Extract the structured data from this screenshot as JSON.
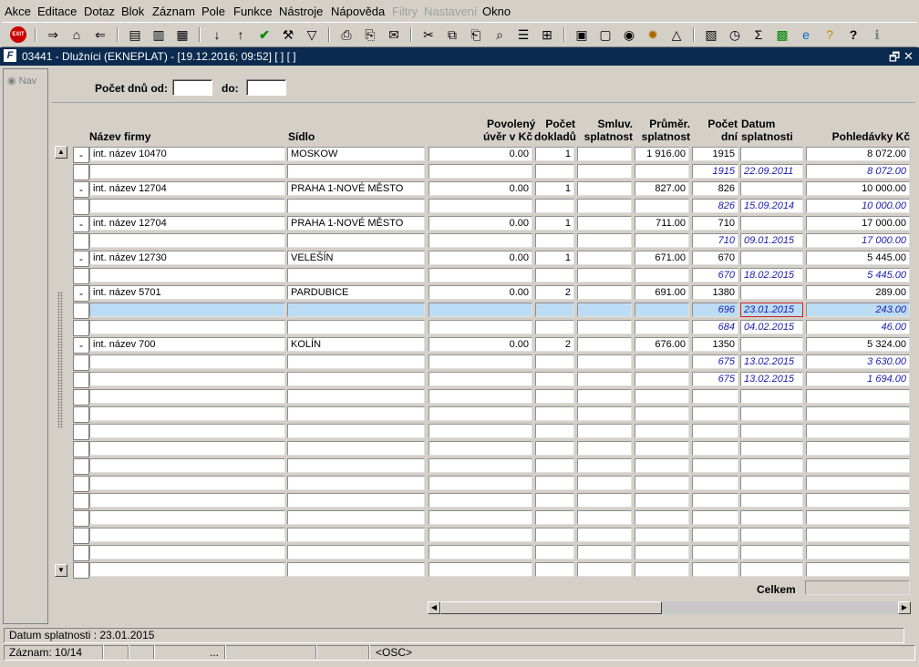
{
  "menu": [
    "Akce",
    "Editace",
    "Dotaz",
    "Blok",
    "Záznam",
    "Pole",
    "Funkce",
    "Nástroje",
    "Nápověda",
    "Filtry",
    "Nastavení",
    "Okno"
  ],
  "menu_disabled": [
    "Filtry",
    "Nastavení"
  ],
  "toolbar": {
    "icons": [
      "exit-icon",
      "insert-record-icon",
      "delete-record-icon",
      "duplicate-record-icon",
      "copy-record-icon",
      "paste-record-icon",
      "clear-record-icon",
      "sort-asc-icon",
      "sort-desc-icon",
      "accept-icon",
      "tools-icon",
      "filter-icon",
      "print-icon",
      "print-setup-icon",
      "email-icon",
      "cut-icon",
      "copy-icon",
      "paste-icon",
      "help-lookup-icon",
      "list-icon",
      "tree-icon",
      "report-icon",
      "document-icon",
      "globe-icon",
      "settings-icon",
      "warning-icon",
      "chart-icon",
      "clock-icon",
      "sum-icon",
      "excel-icon",
      "ie-icon",
      "help-query-icon",
      "help-icon",
      "info-icon"
    ],
    "exit_label": "EXIT"
  },
  "window": {
    "title": "03441 - Dlužníci (EKNEPLAT) - [19.12.2016; 09:52] [ ] [ ]",
    "restore_glyph": "🗗",
    "close_glyph": "✕"
  },
  "nav_label": "Nav",
  "filter": {
    "days_from_label": "Počet dnů od:",
    "days_from_value": "",
    "to_label": "do:",
    "to_value": ""
  },
  "columns": {
    "firm": "Název firmy",
    "seat": "Sídlo",
    "credit_1": "Povolený",
    "credit_2": "úvěr v Kč",
    "docs_1": "Počet",
    "docs_2": "dokladů",
    "contract_1": "Smluv.",
    "contract_2": "splatnost",
    "avg_1": "Průměr.",
    "avg_2": "splatnost",
    "days_1": "Počet",
    "days_2": "dní",
    "due_1": "Datum",
    "due_2": "splatnosti",
    "claims": "Pohledávky Kč"
  },
  "rows": [
    {
      "ind": "-",
      "firm": "int. název 10470",
      "seat": "MOSKOW",
      "credit": "0.00",
      "docs": "1",
      "contract": "",
      "avg": "1 916.00",
      "days": "1915",
      "due": "",
      "claims": "8 072.00",
      "sub": false
    },
    {
      "ind": "",
      "firm": "",
      "seat": "",
      "credit": "",
      "docs": "",
      "contract": "",
      "avg": "",
      "days": "1915",
      "due": "22.09.2011",
      "claims": "8 072.00",
      "sub": true
    },
    {
      "ind": "-",
      "firm": "int. název 12704",
      "seat": "PRAHA 1-NOVÉ MĚSTO",
      "credit": "0.00",
      "docs": "1",
      "contract": "",
      "avg": "827.00",
      "days": "826",
      "due": "",
      "claims": "10 000.00",
      "sub": false
    },
    {
      "ind": "",
      "firm": "",
      "seat": "",
      "credit": "",
      "docs": "",
      "contract": "",
      "avg": "",
      "days": "826",
      "due": "15.09.2014",
      "claims": "10 000.00",
      "sub": true
    },
    {
      "ind": "-",
      "firm": "int. název 12704",
      "seat": "PRAHA 1-NOVÉ MĚSTO",
      "credit": "0.00",
      "docs": "1",
      "contract": "",
      "avg": "711.00",
      "days": "710",
      "due": "",
      "claims": "17 000.00",
      "sub": false
    },
    {
      "ind": "",
      "firm": "",
      "seat": "",
      "credit": "",
      "docs": "",
      "contract": "",
      "avg": "",
      "days": "710",
      "due": "09.01.2015",
      "claims": "17 000.00",
      "sub": true
    },
    {
      "ind": "-",
      "firm": "int. název 12730",
      "seat": "VELEŠÍN",
      "credit": "0.00",
      "docs": "1",
      "contract": "",
      "avg": "671.00",
      "days": "670",
      "due": "",
      "claims": "5 445.00",
      "sub": false
    },
    {
      "ind": "",
      "firm": "",
      "seat": "",
      "credit": "",
      "docs": "",
      "contract": "",
      "avg": "",
      "days": "670",
      "due": "18.02.2015",
      "claims": "5 445.00",
      "sub": true
    },
    {
      "ind": "-",
      "firm": "int. název 5701",
      "seat": "PARDUBICE",
      "credit": "0.00",
      "docs": "2",
      "contract": "",
      "avg": "691.00",
      "days": "1380",
      "due": "",
      "claims": "289.00",
      "sub": false
    },
    {
      "ind": "",
      "firm": "",
      "seat": "",
      "credit": "",
      "docs": "",
      "contract": "",
      "avg": "",
      "days": "696",
      "due": "23.01.2015",
      "claims": "243.00",
      "sub": true,
      "selected": true
    },
    {
      "ind": "",
      "firm": "",
      "seat": "",
      "credit": "",
      "docs": "",
      "contract": "",
      "avg": "",
      "days": "684",
      "due": "04.02.2015",
      "claims": "46.00",
      "sub": true
    },
    {
      "ind": "-",
      "firm": "int. název 700",
      "seat": "KOLÍN",
      "credit": "0.00",
      "docs": "2",
      "contract": "",
      "avg": "676.00",
      "days": "1350",
      "due": "",
      "claims": "5 324.00",
      "sub": false
    },
    {
      "ind": "",
      "firm": "",
      "seat": "",
      "credit": "",
      "docs": "",
      "contract": "",
      "avg": "",
      "days": "675",
      "due": "13.02.2015",
      "claims": "3 630.00",
      "sub": true
    },
    {
      "ind": "",
      "firm": "",
      "seat": "",
      "credit": "",
      "docs": "",
      "contract": "",
      "avg": "",
      "days": "675",
      "due": "13.02.2015",
      "claims": "1 694.00",
      "sub": true
    },
    {
      "ind": "",
      "firm": "",
      "seat": "",
      "credit": "",
      "docs": "",
      "contract": "",
      "avg": "",
      "days": "",
      "due": "",
      "claims": "",
      "sub": false
    },
    {
      "ind": "",
      "firm": "",
      "seat": "",
      "credit": "",
      "docs": "",
      "contract": "",
      "avg": "",
      "days": "",
      "due": "",
      "claims": "",
      "sub": false
    },
    {
      "ind": "",
      "firm": "",
      "seat": "",
      "credit": "",
      "docs": "",
      "contract": "",
      "avg": "",
      "days": "",
      "due": "",
      "claims": "",
      "sub": false
    },
    {
      "ind": "",
      "firm": "",
      "seat": "",
      "credit": "",
      "docs": "",
      "contract": "",
      "avg": "",
      "days": "",
      "due": "",
      "claims": "",
      "sub": false
    },
    {
      "ind": "",
      "firm": "",
      "seat": "",
      "credit": "",
      "docs": "",
      "contract": "",
      "avg": "",
      "days": "",
      "due": "",
      "claims": "",
      "sub": false
    },
    {
      "ind": "",
      "firm": "",
      "seat": "",
      "credit": "",
      "docs": "",
      "contract": "",
      "avg": "",
      "days": "",
      "due": "",
      "claims": "",
      "sub": false
    },
    {
      "ind": "",
      "firm": "",
      "seat": "",
      "credit": "",
      "docs": "",
      "contract": "",
      "avg": "",
      "days": "",
      "due": "",
      "claims": "",
      "sub": false
    },
    {
      "ind": "",
      "firm": "",
      "seat": "",
      "credit": "",
      "docs": "",
      "contract": "",
      "avg": "",
      "days": "",
      "due": "",
      "claims": "",
      "sub": false
    },
    {
      "ind": "",
      "firm": "",
      "seat": "",
      "credit": "",
      "docs": "",
      "contract": "",
      "avg": "",
      "days": "",
      "due": "",
      "claims": "",
      "sub": false
    },
    {
      "ind": "",
      "firm": "",
      "seat": "",
      "credit": "",
      "docs": "",
      "contract": "",
      "avg": "",
      "days": "",
      "due": "",
      "claims": "",
      "sub": false
    },
    {
      "ind": "",
      "firm": "",
      "seat": "",
      "credit": "",
      "docs": "",
      "contract": "",
      "avg": "",
      "days": "",
      "due": "",
      "claims": "",
      "sub": false
    }
  ],
  "total_label": "Celkem",
  "total_value": "",
  "status": {
    "message": "Datum splatnosti : 23.01.2015",
    "record": "Záznam: 10/14",
    "ellipsis": "...",
    "mode": "<OSC>"
  },
  "colors": {
    "titlebar": "#0b2a4f",
    "selected_row": "#bcdcf4",
    "subrow_text": "#1a1ab0",
    "focus_border": "#d02020"
  }
}
